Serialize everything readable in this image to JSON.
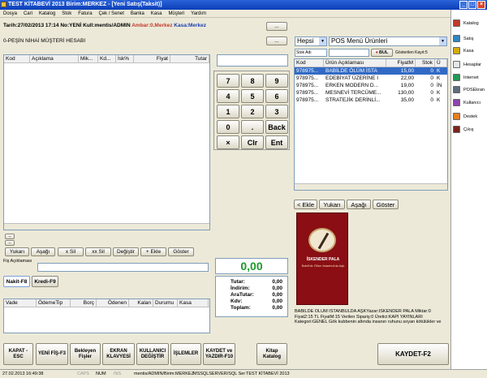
{
  "window": {
    "title": "TEST KİTABEVİ 2013 Birim:MERKEZ - [Yeni Satış(Taksit)]",
    "controls": [
      "_",
      "□",
      "×"
    ]
  },
  "menu": [
    "Dosya",
    "Cari",
    "Katalog",
    "Stok",
    "Fatura",
    "Çek / Senet",
    "Banka",
    "Kasa",
    "Müşteri",
    "Yardım"
  ],
  "info": {
    "prefix": "Tarih:27/02/2013 17:14 No:YENİ Kull:mentis/ADMIN",
    "ambar": "Ambar:0.Merkez",
    "kasa": "Kasa:Merkez",
    "dots": "..."
  },
  "customer": {
    "name": "0-PEŞİN NİHAİ MÜŞTERİ HESABI",
    "dots": "..."
  },
  "sale_table": {
    "headers": [
      "Kod",
      "Açıklama",
      "Mik...",
      "Kd...",
      "İsk%",
      "Fiyat",
      "Tutar"
    ]
  },
  "row_buttons": [
    "Yukarı",
    "Aşağı",
    "x Sil",
    "xx Sil",
    "Değiştir",
    "+ Ekle",
    "Göster"
  ],
  "note_label": "Fiş Açıklaması",
  "tabs": [
    "Nakit-F8",
    "Kredi-F9"
  ],
  "payment_table": {
    "headers": [
      "Vade",
      "ÖdemeTip",
      "Borç",
      "Ödenen",
      "Kalan",
      "Durumu",
      "Kasa"
    ]
  },
  "keypad": [
    "7",
    "8",
    "9",
    "4",
    "5",
    "6",
    "1",
    "2",
    "3",
    "0",
    ".",
    "Back",
    "×",
    "Clr",
    "Ent"
  ],
  "total_display": "0,00",
  "totals": [
    {
      "label": "Tutar:",
      "value": "0,00"
    },
    {
      "label": "İndirim:",
      "value": "0,00"
    },
    {
      "label": "AraTutar:",
      "value": "0,00"
    },
    {
      "label": "Kdv:",
      "value": "0,00"
    },
    {
      "label": "Toplam:",
      "value": "0,00"
    }
  ],
  "products": {
    "filter_value": "Hepsi",
    "menu_select": "POS Menü Ürünleri",
    "search_field": "Stok Adı",
    "search_button": "BUL",
    "count_label": "Gösterilen Kayıt:5",
    "headers": [
      "Kod",
      "Ürün Açıklaması",
      "FiyatM",
      "Stok",
      "Ü"
    ],
    "rows": [
      {
        "kod": "978975...",
        "desc": "BABİLDE ÖLÜM İSTA",
        "fiyat": "15,00",
        "stok": "0",
        "u": "K",
        "selected": true
      },
      {
        "kod": "978975...",
        "desc": "EDEBİYAT ÜZERİNE I",
        "fiyat": "22,00",
        "stok": "0",
        "u": "K",
        "selected": false
      },
      {
        "kod": "978975...",
        "desc": "ERKEN MODERN D...",
        "fiyat": "19,00",
        "stok": "0",
        "u": "İN",
        "selected": false
      },
      {
        "kod": "978975...",
        "desc": "MESNEVİ TERCÜME...",
        "fiyat": "130,00",
        "stok": "0",
        "u": "K",
        "selected": false
      },
      {
        "kod": "978975...",
        "desc": "STRATEJİK DERİNLİ...",
        "fiyat": "35,00",
        "stok": "0",
        "u": "K",
        "selected": false
      }
    ],
    "buttons": [
      "< Ekle",
      "Yukarı",
      "Aşağı",
      "Göster"
    ]
  },
  "book": {
    "cover_author": "İSKENDER PALA",
    "cover_title": "Babil'de Ölüm İstanbul'da Aşk",
    "description": "BABİLDE ÖLÜM İSTANBULDA AŞKYazar:İSKENDER PALA Miktar:0 Fiyat2:15 TL    FiyatM:15 Verilen Sipariş:0 Üretici:KAPI YAYINLARI Kategori:GENEL Gök kubbenin altında insanın ruhunu soyan kötülükler ve"
  },
  "bottom_buttons": [
    "KAPAT -\nESC",
    "YENİ FİŞ-F3",
    "Bekleyen\nFişler",
    "EKRAN\nKLAVYESİ",
    "KULLANICI\nDEĞİŞTİR",
    "İŞLEMLER",
    "KAYDET ve\nYAZDIR-F10",
    "Kitap\nKatalog",
    "KAYDET-F2"
  ],
  "sidebar": [
    "Katalog",
    "Satış",
    "Kasa",
    "Hesaplar",
    "Internet",
    "POSEkran",
    "Kullanıcı",
    "Destek",
    "Çıkış"
  ],
  "sidebar_colors": [
    "#c0392b",
    "#2e86c1",
    "#d4ac0d",
    "#e5e7e9",
    "#229954",
    "#5d6d7e",
    "#8e44ad",
    "#e67e22",
    "#7b241c"
  ],
  "statusbar": [
    "27.02.2013 16:49:38",
    "CAPS",
    "NUM",
    "INS",
    "mentis/ADMIN/Birim:MERKEZ",
    "MSSQLSERVER/SQL Ser",
    "TEST KİTABEVİ 2013"
  ]
}
